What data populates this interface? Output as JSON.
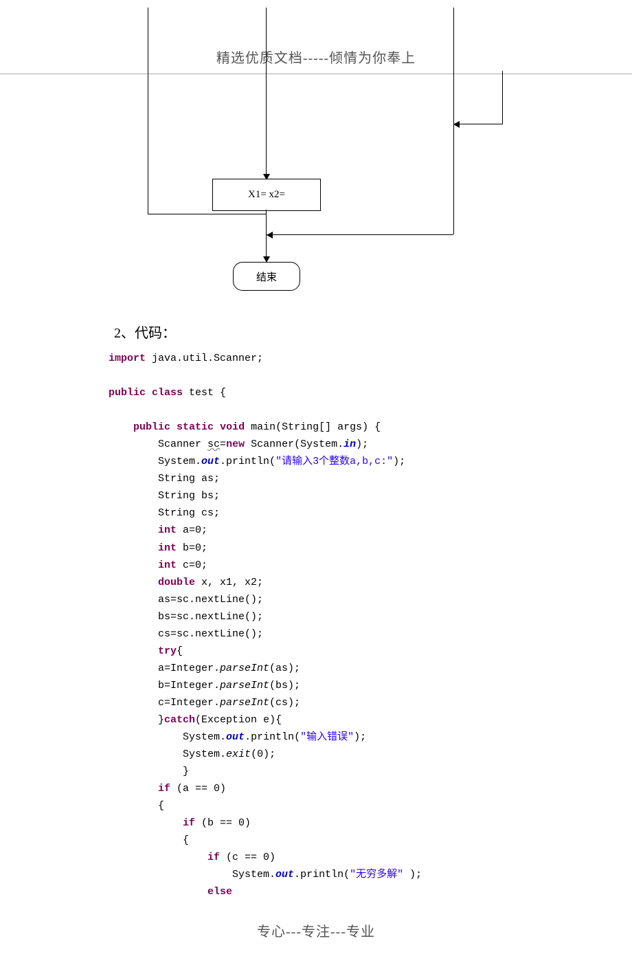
{
  "header": {
    "text": "精选优质文档-----倾情为你奉上"
  },
  "flowchart": {
    "box_label": "X1=    x2=",
    "end_label": "结束"
  },
  "section": {
    "title": "2、代码："
  },
  "code": {
    "l1a": "import",
    "l1b": " java.util.Scanner;",
    "l2a": "public",
    "l2b": " ",
    "l2c": "class",
    "l2d": " test {",
    "l3a": "public",
    "l3b": " ",
    "l3c": "static",
    "l3d": " ",
    "l3e": "void",
    "l3f": " main(String[] args) {",
    "l4a": "Scanner ",
    "l4b": "sc",
    "l4c": "=",
    "l4d": "new",
    "l4e": " Scanner(System.",
    "l4f": "in",
    "l4g": ");",
    "l5a": "System.",
    "l5b": "out",
    "l5c": ".println(",
    "l5d": "\"请输入3个整数a,b,c:\"",
    "l5e": ");",
    "l6": "String as;",
    "l7": "String bs;",
    "l8": "String cs;",
    "l9a": "int",
    "l9b": " a=0;",
    "l10a": "int",
    "l10b": " b=0;",
    "l11a": "int",
    "l11b": " c=0;",
    "l12a": "double",
    "l12b": " x, x1, x2;",
    "l13": "as=sc.nextLine();",
    "l14": "bs=sc.nextLine();",
    "l15": "cs=sc.nextLine();",
    "l16a": "try",
    "l16b": "{",
    "l17a": "a=Integer.",
    "l17b": "parseInt",
    "l17c": "(as);",
    "l18a": "b=Integer.",
    "l18b": "parseInt",
    "l18c": "(bs);",
    "l19a": "c=Integer.",
    "l19b": "parseInt",
    "l19c": "(cs);",
    "l20a": "}",
    "l20b": "catch",
    "l20c": "(Exception e){",
    "l21a": "System.",
    "l21b": "out",
    "l21c": ".println(",
    "l21d": "\"输入错误\"",
    "l21e": ");",
    "l22a": "System.",
    "l22b": "exit",
    "l22c": "(0);",
    "l23": "}",
    "l24a": "if",
    "l24b": " (a == 0)",
    "l25": "{",
    "l26a": "if",
    "l26b": " (b == 0)",
    "l27": "{",
    "l28a": "if",
    "l28b": " (c == 0)",
    "l29a": "System.",
    "l29b": "out",
    "l29c": ".println(",
    "l29d": "\"无穷多解\"",
    "l29e": " );",
    "l30a": "else"
  },
  "footer": {
    "text": "专心---专注---专业"
  }
}
